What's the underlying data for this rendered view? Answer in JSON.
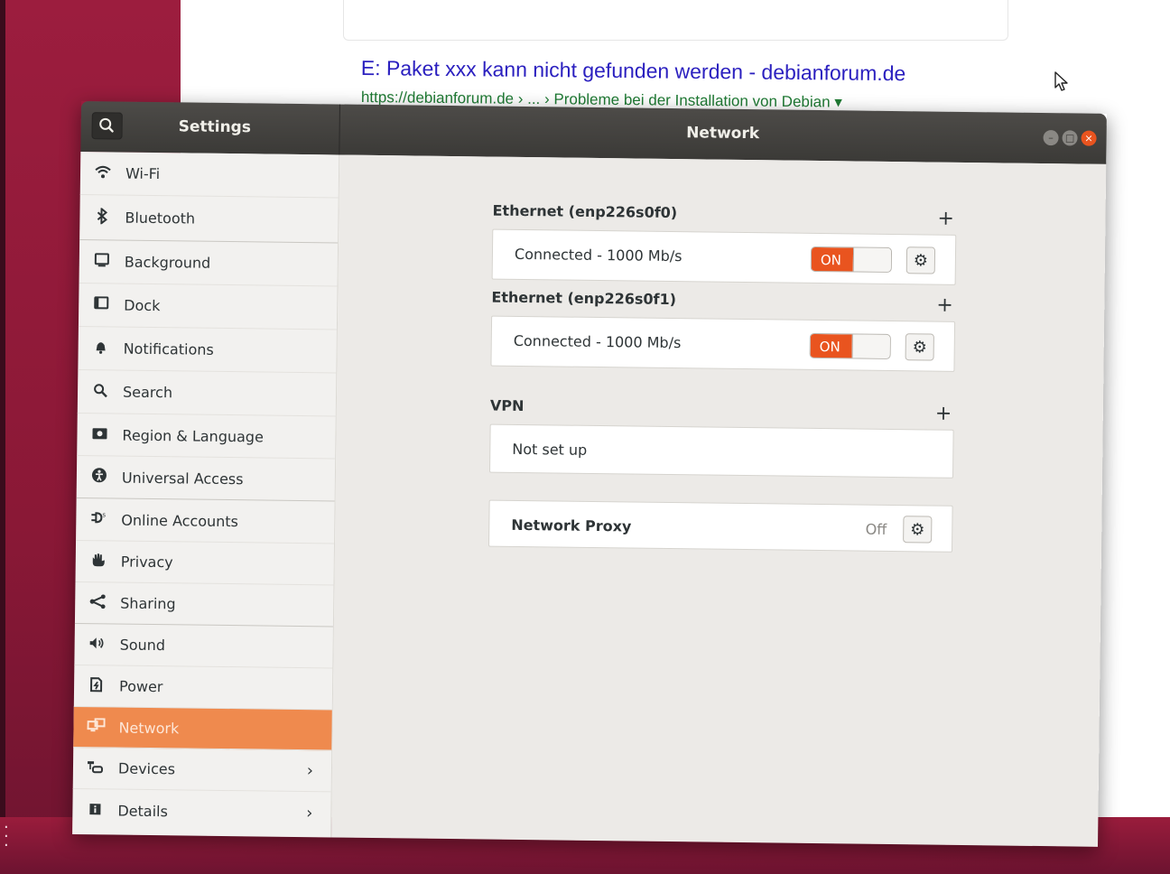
{
  "browser": {
    "result_title": "E: Paket xxx kann nicht gefunden werden - debianforum.de",
    "result_url": "https://debianforum.de › ... › Probleme bei der Installation von Debian ▾"
  },
  "window": {
    "sidebar_title": "Settings",
    "main_title": "Network"
  },
  "sidebar": {
    "items": [
      {
        "label": "Wi-Fi",
        "icon": "wifi-icon"
      },
      {
        "label": "Bluetooth",
        "icon": "bluetooth-icon"
      },
      {
        "label": "Background",
        "icon": "background-icon"
      },
      {
        "label": "Dock",
        "icon": "dock-icon"
      },
      {
        "label": "Notifications",
        "icon": "bell-icon"
      },
      {
        "label": "Search",
        "icon": "search-icon"
      },
      {
        "label": "Region & Language",
        "icon": "region-icon"
      },
      {
        "label": "Universal Access",
        "icon": "accessibility-icon"
      },
      {
        "label": "Online Accounts",
        "icon": "online-accounts-icon"
      },
      {
        "label": "Privacy",
        "icon": "hand-icon"
      },
      {
        "label": "Sharing",
        "icon": "share-icon"
      },
      {
        "label": "Sound",
        "icon": "speaker-icon"
      },
      {
        "label": "Power",
        "icon": "power-icon"
      },
      {
        "label": "Network",
        "icon": "network-icon",
        "active": true
      },
      {
        "label": "Devices",
        "icon": "devices-icon"
      },
      {
        "label": "Details",
        "icon": "info-icon"
      }
    ]
  },
  "network": {
    "ethernet1": {
      "title": "Ethernet (enp226s0f0)",
      "status": "Connected - 1000 Mb/s",
      "switch": "ON"
    },
    "ethernet2": {
      "title": "Ethernet (enp226s0f1)",
      "status": "Connected - 1000 Mb/s",
      "switch": "ON"
    },
    "vpn": {
      "title": "VPN",
      "status": "Not set up"
    },
    "proxy": {
      "label": "Network Proxy",
      "state": "Off"
    }
  },
  "colors": {
    "accent": "#e9541f",
    "sidebar_active": "#ef8a4e",
    "titlebar": "#3b3a37"
  }
}
